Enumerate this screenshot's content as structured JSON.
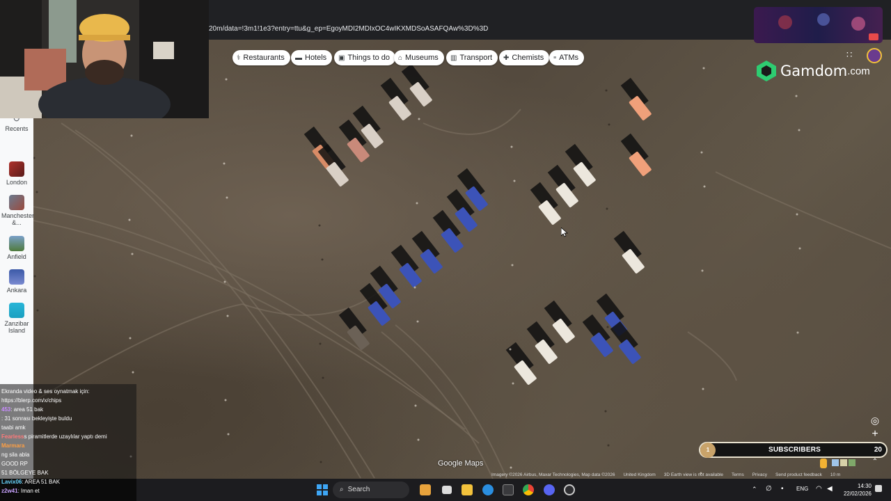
{
  "browser": {
    "url": "20m/data=!3m1!1e3?entry=ttu&g_ep=EgoyMDI2MDIxOC4wIKXMDSoASAFQAw%3D%3D"
  },
  "sidebar": {
    "items": [
      {
        "label": "Recents",
        "icon": "history-icon"
      },
      {
        "label": "London",
        "icon": "place-thumbnail"
      },
      {
        "label": "Manchester &...",
        "icon": "place-thumbnail"
      },
      {
        "label": "Anfield",
        "icon": "place-thumbnail"
      },
      {
        "label": "Ankara",
        "icon": "place-thumbnail"
      },
      {
        "label": "Zanzibar Island",
        "icon": "place-thumbnail"
      }
    ]
  },
  "chips": [
    {
      "label": "Restaurants",
      "icon": "fork-knife-icon"
    },
    {
      "label": "Hotels",
      "icon": "bed-icon"
    },
    {
      "label": "Things to do",
      "icon": "camera-icon"
    },
    {
      "label": "Museums",
      "icon": "museum-icon"
    },
    {
      "label": "Transport",
      "icon": "train-icon"
    },
    {
      "label": "Chemists",
      "icon": "pharmacy-icon"
    },
    {
      "label": "ATMs",
      "icon": "atm-icon"
    }
  ],
  "overlay": {
    "brand": "Gamdom",
    "brand_suffix": ".com"
  },
  "chat": {
    "lines": [
      {
        "user": "",
        "text": "Ekranda video & ses oynatmak için:"
      },
      {
        "user": "",
        "text": "https://blerp.com/x/chips"
      },
      {
        "user": "453",
        "text": ": area 51 bak"
      },
      {
        "user": "",
        "text": ": 31 sonrası bekleyişte buldu"
      },
      {
        "user": "",
        "text": "taabi amk"
      },
      {
        "user": "Fearless",
        "text": "s piramitlerde uzaylılar yaptı demi"
      },
      {
        "user": "Marmara",
        "text": ""
      },
      {
        "user": "",
        "text": "ng sila abla"
      },
      {
        "user": "",
        "text": "GOOD RP"
      },
      {
        "user": "",
        "text": "51 BÖLGEYE BAK"
      },
      {
        "user": "Lavix06",
        "text": ": AREA 51 BAK"
      },
      {
        "user": "z2w41",
        "text": ": Iman et"
      }
    ]
  },
  "subscribers": {
    "label": "SUBSCRIBERS",
    "badge": "1",
    "count": "20"
  },
  "map": {
    "logo": "Google Maps",
    "attribution": [
      "Imagery ©2026 Airbus, Maxar Technologies, Map data ©2026",
      "United Kingdom",
      "3D Earth view is not available",
      "Terms",
      "Privacy",
      "Send product feedback",
      "10 m"
    ]
  },
  "taskbar": {
    "search_label": "Search",
    "language": "ENG",
    "time": "14:30",
    "date": "22/02/2026"
  },
  "colors": {
    "browser_bg": "#202124",
    "chip_bg": "#ffffff",
    "gamdom_green": "#2ecc71",
    "taskbar_bg": "#1c1c1f"
  }
}
